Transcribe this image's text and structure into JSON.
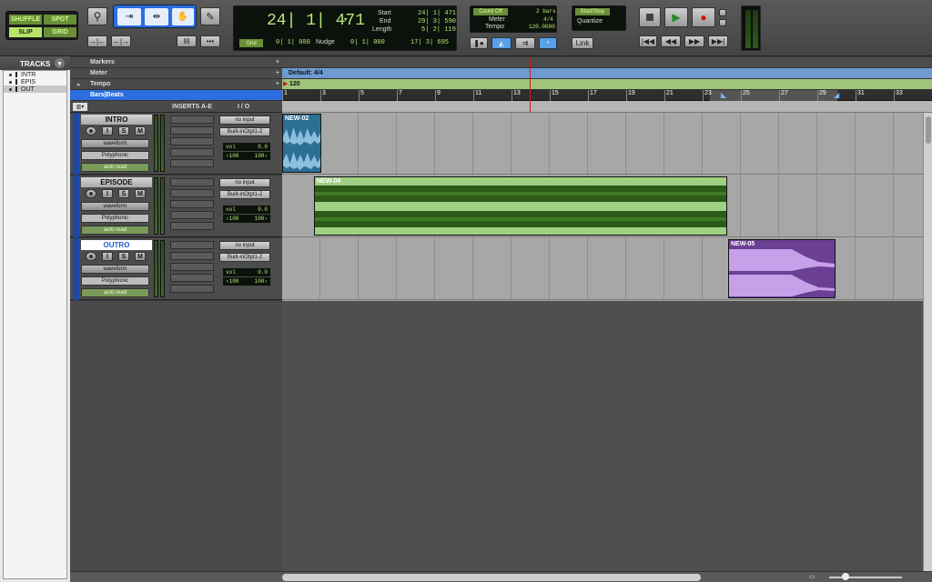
{
  "toolbar": {
    "edit_modes": [
      "SHUFFLE",
      "SPOT",
      "SLIP",
      "GRID"
    ],
    "counter_main": "24| 1| 471",
    "counter_arrow": "▾",
    "start_label": "Start",
    "end_label": "End",
    "length_label": "Length",
    "start_value": "24| 1| 471",
    "end_value": "29| 3| 590",
    "length_value": "5| 2| 119",
    "grid_label": "Grid",
    "grid_value": "0| 1| 000",
    "nudge_label": "Nudge",
    "nudge_value": "0| 1| 000",
    "nudge_extra": "17| 3| 695",
    "count_off_label": "Count Off",
    "count_off_value": "2 bars",
    "meter_label": "Meter",
    "meter_value": "4/4",
    "tempo_label": "Tempo",
    "tempo_value": "120.0000",
    "start_stop_label": "Start/Stop",
    "quantize_label": "Quantize",
    "link_label": "Link"
  },
  "tracks_panel": {
    "title": "TRACKS",
    "items": [
      "INTR",
      "EPIS",
      "OUT"
    ]
  },
  "rulers": {
    "markers": "Markers",
    "meter": "Meter",
    "tempo": "Tempo",
    "bars_beats": "Bars|Beats",
    "meter_value": "Default: 4/4",
    "tempo_value": "120",
    "bar_numbers": [
      "1",
      "3",
      "5",
      "7",
      "9",
      "11",
      "13",
      "15",
      "17",
      "19",
      "21",
      "23",
      "25",
      "27",
      "29",
      "31",
      "33"
    ]
  },
  "headers": {
    "inserts": "INSERTS A-E",
    "io": "I / O"
  },
  "tracks": [
    {
      "name": "INTRO",
      "view": "waveform",
      "mode": "Polyphonic",
      "auto": "auto read",
      "input": "no input",
      "output": "Built-inOtpt1-2",
      "vol_label": "vol",
      "vol": "0.0",
      "pan_l": "‹100",
      "pan_r": "100›"
    },
    {
      "name": "EPISODE",
      "view": "waveform",
      "mode": "Polyphonic",
      "auto": "auto read",
      "input": "no input",
      "output": "Built-inOtpt1-2",
      "vol_label": "vol",
      "vol": "0.0",
      "pan_l": "‹100",
      "pan_r": "100›"
    },
    {
      "name": "OUTRO",
      "view": "waveform",
      "mode": "Polyphonic",
      "auto": "auto read",
      "input": "no input",
      "output": "Built-inOtpt1-2",
      "vol_label": "vol",
      "vol": "0.0",
      "pan_l": "‹100",
      "pan_r": "100›"
    }
  ],
  "clips": [
    {
      "name": "NEW-02",
      "color": "#2e6f96"
    },
    {
      "name": "NEW-04",
      "color": "#9ed183"
    },
    {
      "name": "NEW-05",
      "color": "#9c6cc8"
    }
  ],
  "track_buttons": [
    "I",
    "S",
    "M"
  ]
}
